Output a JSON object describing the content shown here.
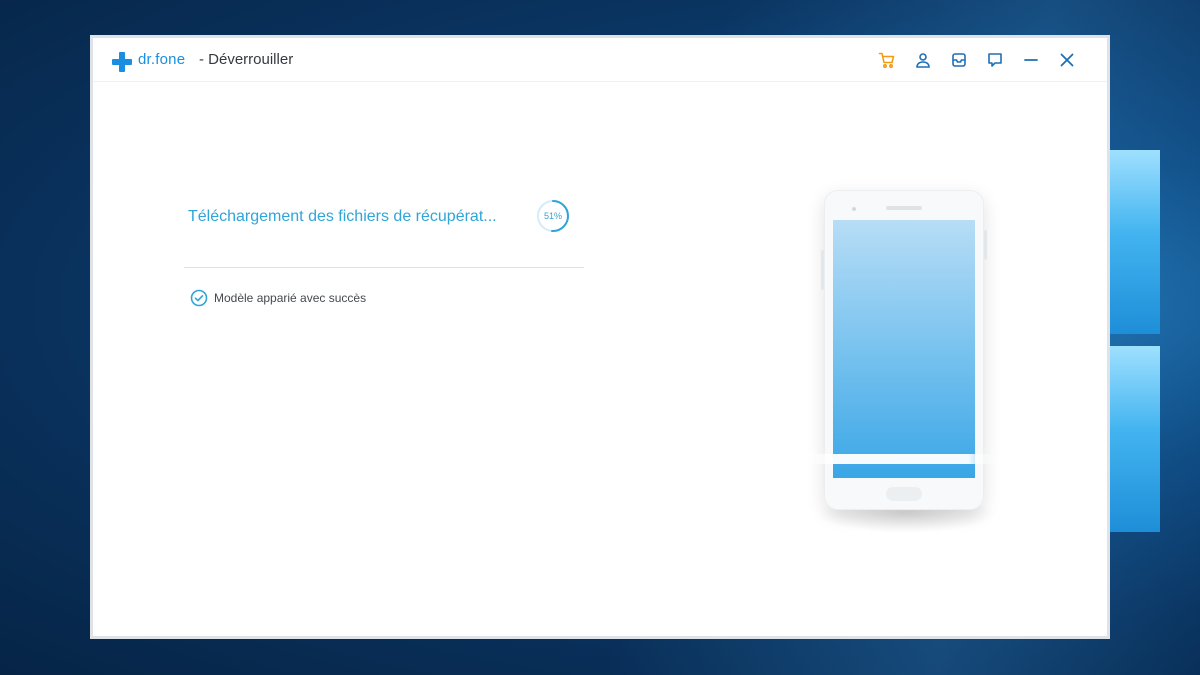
{
  "window": {
    "brand": "dr.fone",
    "title": "- Déverrouiller"
  },
  "toolbar": {
    "icons": [
      "cart-icon",
      "user-icon",
      "inbox-icon",
      "feedback-icon",
      "minimize-icon",
      "close-icon"
    ]
  },
  "progress": {
    "text": "Téléchargement des fichiers de récupérat...",
    "percent_label": "51%",
    "value": 0.51
  },
  "status": {
    "message": "Modèle apparié avec succès"
  },
  "colors": {
    "accent": "#2fa5d8",
    "brand": "#1a8fe0",
    "cart": "#f39c12"
  }
}
